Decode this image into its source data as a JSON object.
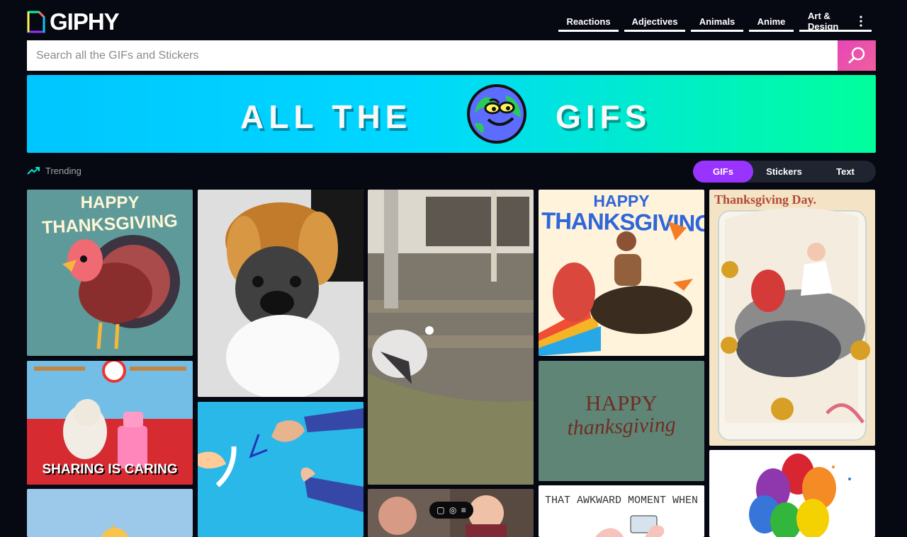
{
  "app": {
    "brand": "GIPHY"
  },
  "nav": {
    "items": [
      "Reactions",
      "Adjectives",
      "Animals",
      "Anime",
      "Art & Design"
    ],
    "more_icon": "vertical-ellipsis-icon"
  },
  "search": {
    "placeholder": "Search all the GIFs and Stickers",
    "value": "",
    "icon": "search-icon"
  },
  "banner": {
    "left_text": "ALL THE",
    "right_text": "GIFS"
  },
  "trending": {
    "label": "Trending",
    "icon": "trending-up-icon"
  },
  "content_toggle": {
    "items": [
      "GIFs",
      "Stickers",
      "Text"
    ],
    "selected": "GIFs"
  },
  "tiles": {
    "t1": {
      "line1": "HAPPY",
      "line2": "THANKSGIVING"
    },
    "t2": {
      "caption": "SHARING IS CARING"
    },
    "t3": {
      "line1": "HAPPY",
      "line2": "THANKSGIVING"
    },
    "t4": {
      "line1": "HAPPY",
      "line2": "thanksgiving"
    },
    "t5": {
      "title": "Thanksgiving Day."
    },
    "t6": {
      "caption": "THAT AWKWARD MOMENT WHEN"
    }
  },
  "colors": {
    "accent": "#9933ff",
    "search": "#e646b6",
    "background": "#060812"
  }
}
